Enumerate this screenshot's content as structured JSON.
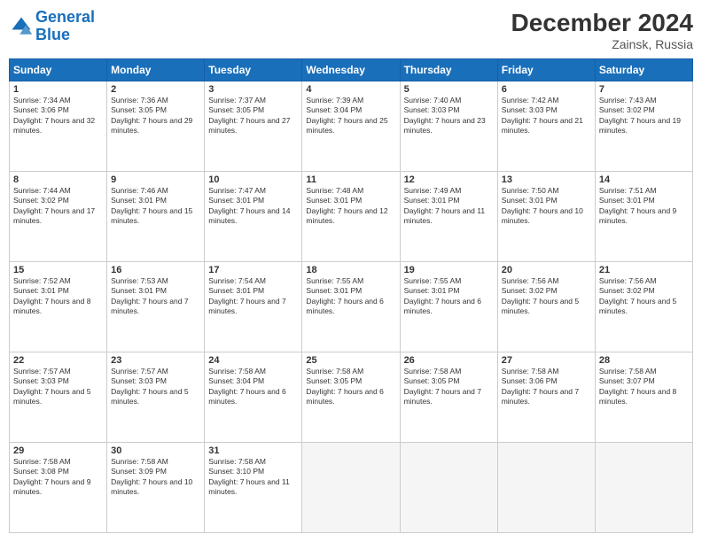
{
  "header": {
    "logo_line1": "General",
    "logo_line2": "Blue",
    "month": "December 2024",
    "location": "Zainsk, Russia"
  },
  "days_of_week": [
    "Sunday",
    "Monday",
    "Tuesday",
    "Wednesday",
    "Thursday",
    "Friday",
    "Saturday"
  ],
  "weeks": [
    [
      {
        "day": 1,
        "sunrise": "Sunrise: 7:34 AM",
        "sunset": "Sunset: 3:06 PM",
        "daylight": "Daylight: 7 hours and 32 minutes."
      },
      {
        "day": 2,
        "sunrise": "Sunrise: 7:36 AM",
        "sunset": "Sunset: 3:05 PM",
        "daylight": "Daylight: 7 hours and 29 minutes."
      },
      {
        "day": 3,
        "sunrise": "Sunrise: 7:37 AM",
        "sunset": "Sunset: 3:05 PM",
        "daylight": "Daylight: 7 hours and 27 minutes."
      },
      {
        "day": 4,
        "sunrise": "Sunrise: 7:39 AM",
        "sunset": "Sunset: 3:04 PM",
        "daylight": "Daylight: 7 hours and 25 minutes."
      },
      {
        "day": 5,
        "sunrise": "Sunrise: 7:40 AM",
        "sunset": "Sunset: 3:03 PM",
        "daylight": "Daylight: 7 hours and 23 minutes."
      },
      {
        "day": 6,
        "sunrise": "Sunrise: 7:42 AM",
        "sunset": "Sunset: 3:03 PM",
        "daylight": "Daylight: 7 hours and 21 minutes."
      },
      {
        "day": 7,
        "sunrise": "Sunrise: 7:43 AM",
        "sunset": "Sunset: 3:02 PM",
        "daylight": "Daylight: 7 hours and 19 minutes."
      }
    ],
    [
      {
        "day": 8,
        "sunrise": "Sunrise: 7:44 AM",
        "sunset": "Sunset: 3:02 PM",
        "daylight": "Daylight: 7 hours and 17 minutes."
      },
      {
        "day": 9,
        "sunrise": "Sunrise: 7:46 AM",
        "sunset": "Sunset: 3:01 PM",
        "daylight": "Daylight: 7 hours and 15 minutes."
      },
      {
        "day": 10,
        "sunrise": "Sunrise: 7:47 AM",
        "sunset": "Sunset: 3:01 PM",
        "daylight": "Daylight: 7 hours and 14 minutes."
      },
      {
        "day": 11,
        "sunrise": "Sunrise: 7:48 AM",
        "sunset": "Sunset: 3:01 PM",
        "daylight": "Daylight: 7 hours and 12 minutes."
      },
      {
        "day": 12,
        "sunrise": "Sunrise: 7:49 AM",
        "sunset": "Sunset: 3:01 PM",
        "daylight": "Daylight: 7 hours and 11 minutes."
      },
      {
        "day": 13,
        "sunrise": "Sunrise: 7:50 AM",
        "sunset": "Sunset: 3:01 PM",
        "daylight": "Daylight: 7 hours and 10 minutes."
      },
      {
        "day": 14,
        "sunrise": "Sunrise: 7:51 AM",
        "sunset": "Sunset: 3:01 PM",
        "daylight": "Daylight: 7 hours and 9 minutes."
      }
    ],
    [
      {
        "day": 15,
        "sunrise": "Sunrise: 7:52 AM",
        "sunset": "Sunset: 3:01 PM",
        "daylight": "Daylight: 7 hours and 8 minutes."
      },
      {
        "day": 16,
        "sunrise": "Sunrise: 7:53 AM",
        "sunset": "Sunset: 3:01 PM",
        "daylight": "Daylight: 7 hours and 7 minutes."
      },
      {
        "day": 17,
        "sunrise": "Sunrise: 7:54 AM",
        "sunset": "Sunset: 3:01 PM",
        "daylight": "Daylight: 7 hours and 7 minutes."
      },
      {
        "day": 18,
        "sunrise": "Sunrise: 7:55 AM",
        "sunset": "Sunset: 3:01 PM",
        "daylight": "Daylight: 7 hours and 6 minutes."
      },
      {
        "day": 19,
        "sunrise": "Sunrise: 7:55 AM",
        "sunset": "Sunset: 3:01 PM",
        "daylight": "Daylight: 7 hours and 6 minutes."
      },
      {
        "day": 20,
        "sunrise": "Sunrise: 7:56 AM",
        "sunset": "Sunset: 3:02 PM",
        "daylight": "Daylight: 7 hours and 5 minutes."
      },
      {
        "day": 21,
        "sunrise": "Sunrise: 7:56 AM",
        "sunset": "Sunset: 3:02 PM",
        "daylight": "Daylight: 7 hours and 5 minutes."
      }
    ],
    [
      {
        "day": 22,
        "sunrise": "Sunrise: 7:57 AM",
        "sunset": "Sunset: 3:03 PM",
        "daylight": "Daylight: 7 hours and 5 minutes."
      },
      {
        "day": 23,
        "sunrise": "Sunrise: 7:57 AM",
        "sunset": "Sunset: 3:03 PM",
        "daylight": "Daylight: 7 hours and 5 minutes."
      },
      {
        "day": 24,
        "sunrise": "Sunrise: 7:58 AM",
        "sunset": "Sunset: 3:04 PM",
        "daylight": "Daylight: 7 hours and 6 minutes."
      },
      {
        "day": 25,
        "sunrise": "Sunrise: 7:58 AM",
        "sunset": "Sunset: 3:05 PM",
        "daylight": "Daylight: 7 hours and 6 minutes."
      },
      {
        "day": 26,
        "sunrise": "Sunrise: 7:58 AM",
        "sunset": "Sunset: 3:05 PM",
        "daylight": "Daylight: 7 hours and 7 minutes."
      },
      {
        "day": 27,
        "sunrise": "Sunrise: 7:58 AM",
        "sunset": "Sunset: 3:06 PM",
        "daylight": "Daylight: 7 hours and 7 minutes."
      },
      {
        "day": 28,
        "sunrise": "Sunrise: 7:58 AM",
        "sunset": "Sunset: 3:07 PM",
        "daylight": "Daylight: 7 hours and 8 minutes."
      }
    ],
    [
      {
        "day": 29,
        "sunrise": "Sunrise: 7:58 AM",
        "sunset": "Sunset: 3:08 PM",
        "daylight": "Daylight: 7 hours and 9 minutes."
      },
      {
        "day": 30,
        "sunrise": "Sunrise: 7:58 AM",
        "sunset": "Sunset: 3:09 PM",
        "daylight": "Daylight: 7 hours and 10 minutes."
      },
      {
        "day": 31,
        "sunrise": "Sunrise: 7:58 AM",
        "sunset": "Sunset: 3:10 PM",
        "daylight": "Daylight: 7 hours and 11 minutes."
      },
      null,
      null,
      null,
      null
    ]
  ]
}
